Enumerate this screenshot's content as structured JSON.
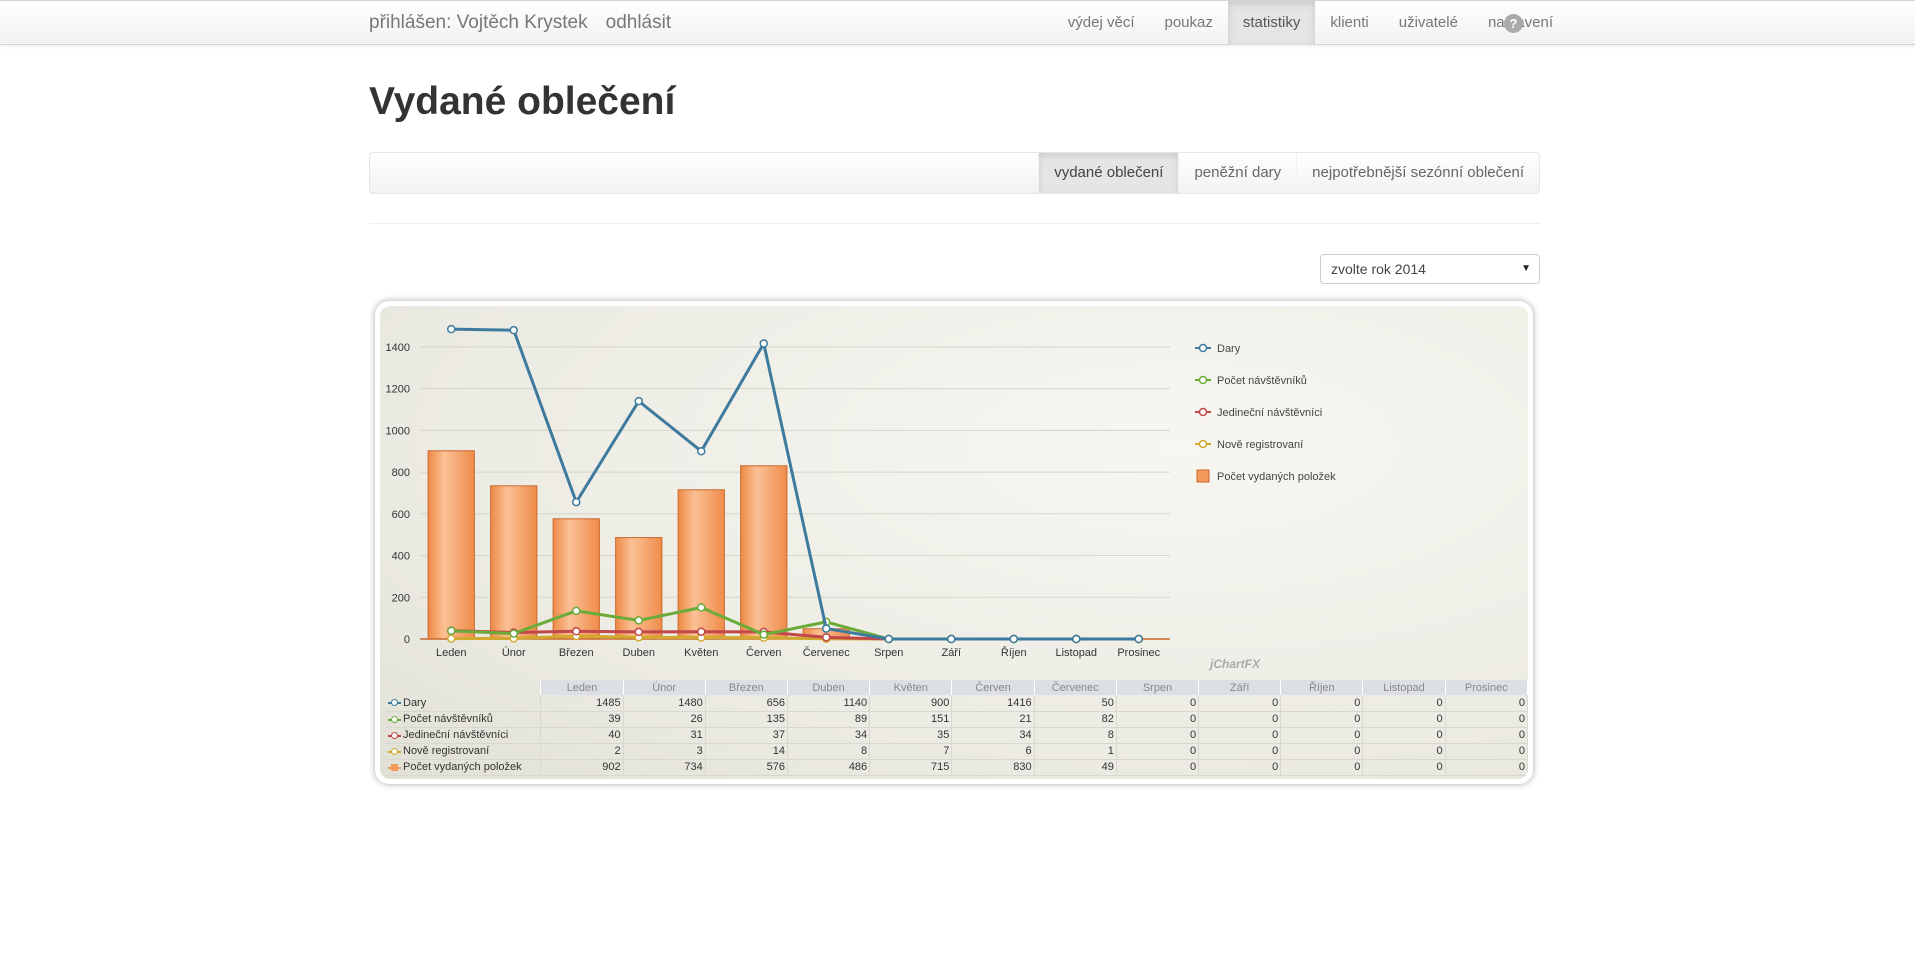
{
  "navbar": {
    "logged_in": "přihlášen: Vojtěch Krystek",
    "logout": "odhlásit",
    "items": [
      "výdej věcí",
      "poukaz",
      "statistiky",
      "klienti",
      "uživatelé",
      "nastavení"
    ],
    "active": "statistiky",
    "help": "?"
  },
  "page_title": "Vydané oblečení",
  "subnav": {
    "tabs": [
      "vydané oblečení",
      "peněžní dary",
      "nejpotřebnější sezónní oblečení"
    ],
    "active": "vydané oblečení"
  },
  "year_select": {
    "value": "zvolte rok 2014",
    "caret": "▼"
  },
  "chart_data": {
    "type": "bar+line",
    "categories": [
      "Leden",
      "Únor",
      "Březen",
      "Duben",
      "Květen",
      "Červen",
      "Červenec",
      "Srpen",
      "Září",
      "Říjen",
      "Listopad",
      "Prosinec"
    ],
    "yticks": [
      0,
      200,
      400,
      600,
      800,
      1000,
      1200,
      1400
    ],
    "ylim": [
      0,
      1500
    ],
    "grid": true,
    "legend_placement": "right",
    "watermark": "jChartFX",
    "series": [
      {
        "name": "Dary",
        "kind": "line",
        "color": "#3d7a9e",
        "values": [
          1485,
          1480,
          656,
          1140,
          900,
          1416,
          50,
          0,
          0,
          0,
          0,
          0
        ]
      },
      {
        "name": "Počet návštěvníků",
        "kind": "line",
        "color": "#6aab3a",
        "values": [
          39,
          26,
          135,
          89,
          151,
          21,
          82,
          0,
          0,
          0,
          0,
          0
        ]
      },
      {
        "name": "Jedineční návštěvníci",
        "kind": "line",
        "color": "#c0474a",
        "values": [
          40,
          31,
          37,
          34,
          35,
          34,
          8,
          0,
          0,
          0,
          0,
          0
        ]
      },
      {
        "name": "Nově registrovaní",
        "kind": "line",
        "color": "#d1a92e",
        "values": [
          2,
          3,
          14,
          8,
          7,
          6,
          1,
          0,
          0,
          0,
          0,
          0
        ]
      },
      {
        "name": "Počet vydaných položek",
        "kind": "bar",
        "color": "#f39a5b",
        "values": [
          902,
          734,
          576,
          486,
          715,
          830,
          49,
          0,
          0,
          0,
          0,
          0
        ]
      }
    ]
  }
}
